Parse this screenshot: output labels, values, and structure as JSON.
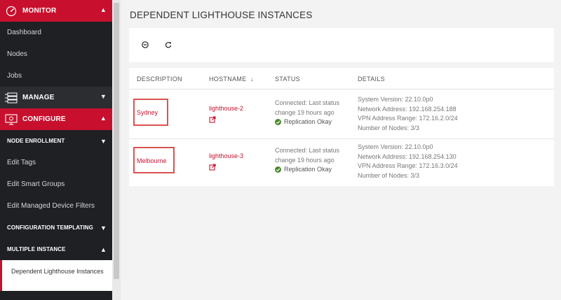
{
  "sidebar": {
    "monitor": {
      "label": "MONITOR",
      "items": [
        "Dashboard",
        "Nodes",
        "Jobs"
      ]
    },
    "manage": {
      "label": "MANAGE"
    },
    "configure": {
      "label": "CONFIGURE"
    },
    "config_items": {
      "node_enrollment": "NODE ENROLLMENT",
      "edit_tags": "Edit Tags",
      "edit_smart_groups": "Edit Smart Groups",
      "edit_managed_device_filters": "Edit Managed Device Filters",
      "configuration_templating": "CONFIGURATION TEMPLATING",
      "multiple_instance": "MULTIPLE INSTANCE",
      "dependent_lighthouse_instances": "Dependent Lighthouse Instances"
    },
    "colors": {
      "accent": "#c8102e",
      "bg": "#1e2024"
    }
  },
  "main": {
    "title": "DEPENDENT LIGHTHOUSE INSTANCES",
    "toolbar": {
      "icons": [
        "remove-circle-icon",
        "refresh-icon"
      ]
    },
    "table": {
      "headers": {
        "description": "DESCRIPTION",
        "hostname": "HOSTNAME",
        "status": "STATUS",
        "details": "DETAILS"
      },
      "rows": [
        {
          "description": "Sydney",
          "hostname": "lighthouse-2",
          "status_line1": "Connected: Last status",
          "status_line2": "change 19 hours ago",
          "replication": "Replication Okay",
          "details": [
            "System Version: 22.10.0p0",
            "Network Address: 192.168.254.188",
            "VPN Address Range: 172.16.2.0/24",
            "Number of Nodes: 3/3"
          ]
        },
        {
          "description": "Melbourne",
          "hostname": "lighthouse-3",
          "status_line1": "Connected: Last status",
          "status_line2": "change 19 hours ago",
          "replication": "Replication Okay",
          "details": [
            "System Version: 22.10.0p0",
            "Network Address: 192.168.254.130",
            "VPN Address Range: 172.16.3.0/24",
            "Number of Nodes: 3/3"
          ]
        }
      ]
    }
  }
}
